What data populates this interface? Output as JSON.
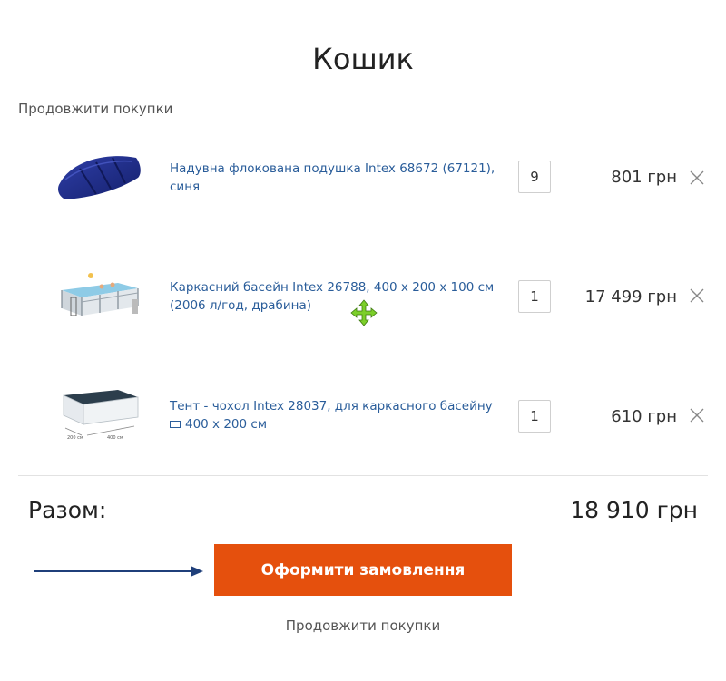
{
  "page": {
    "title": "Кошик",
    "continue_top": "Продовжити покупки",
    "continue_bottom": "Продовжити покупки"
  },
  "cart": {
    "items": [
      {
        "name_line1": "Надувна флокована подушка Intex 68672 (67121),",
        "name_line2": "синя",
        "quantity": "9",
        "price": "801 грн",
        "thumb": "pillow-image"
      },
      {
        "name_line1": "Каркасний басейн Intex 26788, 400 x 200 x 100 см",
        "name_line2": "(2006 л/год, драбина)",
        "quantity": "1",
        "price": "17 499 грн",
        "thumb": "pool-image"
      },
      {
        "name_line1": "Тент - чохол Intex 28037, для каркасного басейну",
        "name_line2": "400 x 200 см",
        "quantity": "1",
        "price": "610 грн",
        "thumb": "pool-cover-image",
        "name_icon": "rectangle-icon"
      }
    ],
    "remove_icon": "close-icon"
  },
  "summary": {
    "total_label": "Разом:",
    "total_value": "18 910 грн"
  },
  "checkout": {
    "button_label": "Оформити замовлення",
    "button_color": "#e5500d"
  },
  "annotation": {
    "arrow_color": "#1f3f7a"
  },
  "colors": {
    "link": "#2a5d9a",
    "cursor": "#7ccf2a"
  }
}
